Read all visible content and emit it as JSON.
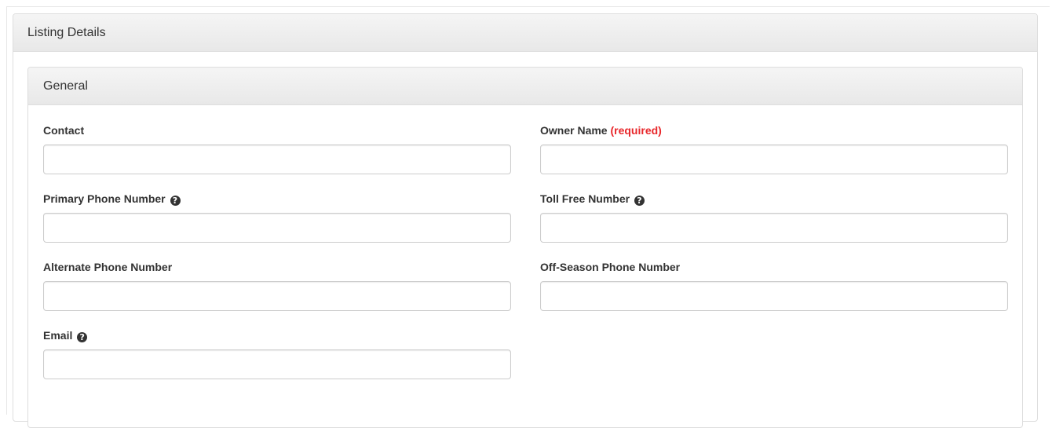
{
  "outer_panel": {
    "title": "Listing Details"
  },
  "inner_panel": {
    "title": "General"
  },
  "fields": {
    "contact": {
      "label": "Contact",
      "value": "",
      "placeholder": ""
    },
    "owner_name": {
      "label": "Owner Name",
      "required_text": "(required)",
      "value": "",
      "placeholder": ""
    },
    "primary_phone": {
      "label": "Primary Phone Number",
      "value": "",
      "placeholder": ""
    },
    "toll_free": {
      "label": "Toll Free Number",
      "value": "",
      "placeholder": ""
    },
    "alternate_phone": {
      "label": "Alternate Phone Number",
      "value": "",
      "placeholder": ""
    },
    "off_season_phone": {
      "label": "Off-Season Phone Number",
      "value": "",
      "placeholder": ""
    },
    "email": {
      "label": "Email",
      "value": "",
      "placeholder": ""
    }
  },
  "icons": {
    "help_glyph": "?"
  },
  "colors": {
    "required": "#e8262a",
    "heading_bg": "#f5f5f5",
    "border": "#dddddd"
  }
}
